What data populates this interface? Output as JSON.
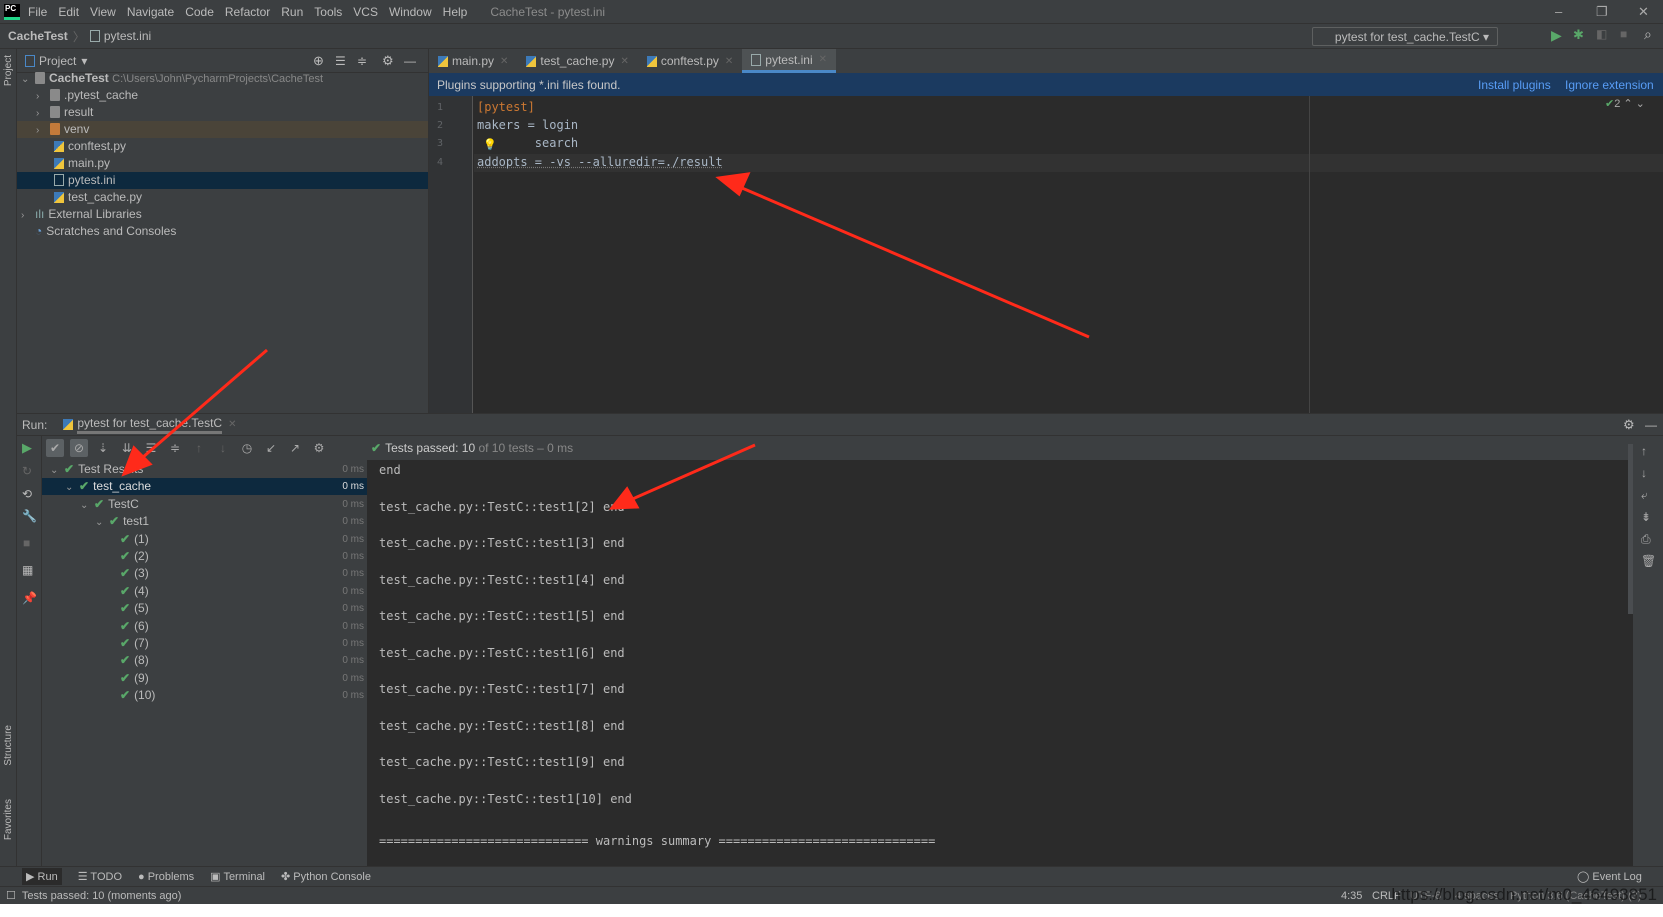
{
  "menu": {
    "items": [
      "File",
      "Edit",
      "View",
      "Navigate",
      "Code",
      "Refactor",
      "Run",
      "Tools",
      "VCS",
      "Window",
      "Help"
    ],
    "title": "CacheTest - pytest.ini"
  },
  "nav": {
    "project": "CacheTest",
    "file": "pytest.ini",
    "run_config": "pytest for test_cache.TestC"
  },
  "project": {
    "header": "Project",
    "tree": [
      {
        "label": "CacheTest",
        "path": "C:\\Users\\John\\PycharmProjects\\CacheTest",
        "type": "folder"
      },
      {
        "label": ".pytest_cache",
        "type": "folder"
      },
      {
        "label": "result",
        "type": "folder"
      },
      {
        "label": "venv",
        "type": "folder"
      },
      {
        "label": "conftest.py",
        "type": "py"
      },
      {
        "label": "main.py",
        "type": "py"
      },
      {
        "label": "pytest.ini",
        "type": "ini"
      },
      {
        "label": "test_cache.py",
        "type": "py"
      },
      {
        "label": "External Libraries",
        "type": "lib"
      },
      {
        "label": "Scratches and Consoles",
        "type": "scratch"
      }
    ]
  },
  "side_tabs": {
    "project": "Project",
    "structure": "Structure",
    "favorites": "Favorites"
  },
  "editor": {
    "tabs": [
      "main.py",
      "test_cache.py",
      "conftest.py",
      "pytest.ini"
    ],
    "active_tab": "pytest.ini",
    "notification": "Plugins supporting *.ini files found.",
    "install": "Install plugins",
    "ignore": "Ignore extension",
    "inspections": "2",
    "lines": [
      "[pytest]",
      "makers = login",
      "        search",
      "addopts = -vs --alluredir=./result"
    ],
    "line_numbers": [
      "1",
      "2",
      "3",
      "4"
    ]
  },
  "run": {
    "label": "Run:",
    "tab": "pytest for test_cache.TestC",
    "status_bold": "Tests passed: 10",
    "status_rest": "of 10 tests – 0 ms",
    "tree": [
      {
        "label": "Test Results",
        "time": "0 ms"
      },
      {
        "label": "test_cache",
        "time": "0 ms"
      },
      {
        "label": "TestC",
        "time": "0 ms"
      },
      {
        "label": "test1",
        "time": "0 ms"
      },
      {
        "label": "(1)",
        "time": "0 ms"
      },
      {
        "label": "(2)",
        "time": "0 ms"
      },
      {
        "label": "(3)",
        "time": "0 ms"
      },
      {
        "label": "(4)",
        "time": "0 ms"
      },
      {
        "label": "(5)",
        "time": "0 ms"
      },
      {
        "label": "(6)",
        "time": "0 ms"
      },
      {
        "label": "(7)",
        "time": "0 ms"
      },
      {
        "label": "(8)",
        "time": "0 ms"
      },
      {
        "label": "(9)",
        "time": "0 ms"
      },
      {
        "label": "(10)",
        "time": "0 ms"
      }
    ],
    "console": [
      "end",
      "test_cache.py::TestC::test1[2] end",
      "test_cache.py::TestC::test1[3] end",
      "test_cache.py::TestC::test1[4] end",
      "test_cache.py::TestC::test1[5] end",
      "test_cache.py::TestC::test1[6] end",
      "test_cache.py::TestC::test1[7] end",
      "test_cache.py::TestC::test1[8] end",
      "test_cache.py::TestC::test1[9] end",
      "test_cache.py::TestC::test1[10] end",
      "============================= warnings summary =============================="
    ]
  },
  "bottom_tabs": [
    "Run",
    "TODO",
    "Problems",
    "Terminal",
    "Python Console"
  ],
  "event_log": "Event Log",
  "status": {
    "message": "Tests passed: 10 (moments ago)",
    "position": "4:35",
    "line_sep": "CRLF",
    "encoding": "UTF-8",
    "indent": "4 spaces",
    "interpreter": "Python 3.6 (CacheTest) (3)"
  },
  "watermark": "https://blog.csdn.net/m0_46493851",
  "colors": {
    "annotation_arrow": "#ff2a1a",
    "pass": "#59a869",
    "selection": "#0d293e",
    "notification": "#1b3a60"
  }
}
